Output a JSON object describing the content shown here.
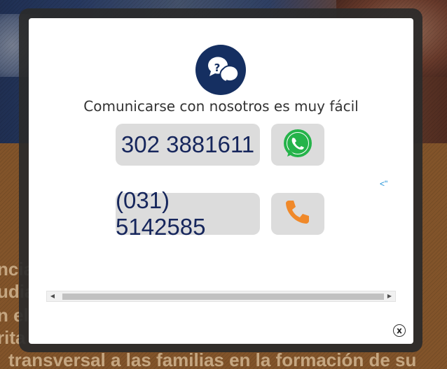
{
  "modal": {
    "heading": "Comunicarse con nosotros es muy fácil",
    "contacts": [
      {
        "number": "302 3881611",
        "action_icon": "whatsapp-icon"
      },
      {
        "number": "(031) 5142585",
        "action_icon": "phone-icon"
      }
    ],
    "side_link": "<\"",
    "close_label": "x"
  },
  "background": {
    "lines": [
      "ncia                                                                egra",
      "udia                                                                vas",
      "n el                                                                nene",
      "rita                                                                 ene",
      "transversal a las familias en la formación de su"
    ]
  },
  "colors": {
    "icon_circle": "#152f61",
    "button_bg": "#dcdcdc",
    "number_text": "#16265c",
    "whatsapp": "#25b34a",
    "phone": "#f0892a"
  }
}
